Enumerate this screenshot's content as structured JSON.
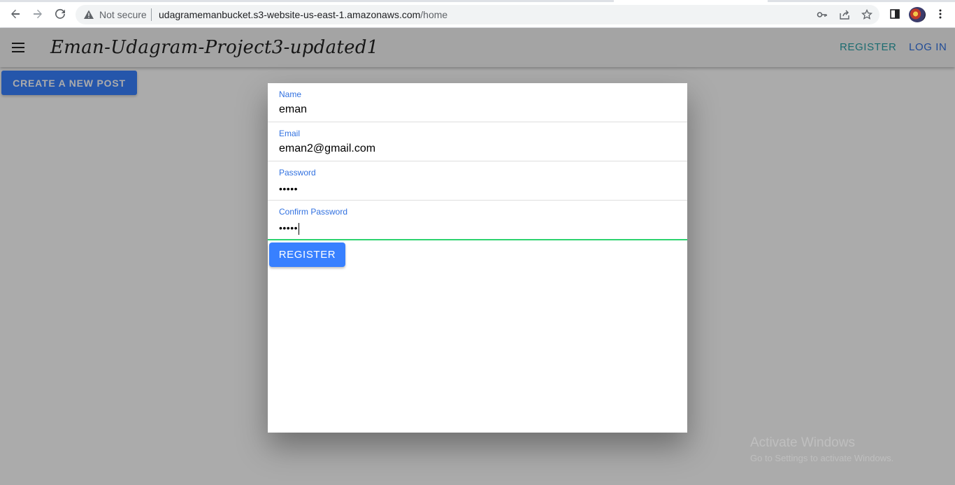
{
  "browser": {
    "security_status": "Not secure",
    "url_host": "udagramemanbucket.s3-website-us-east-1.amazonaws.com",
    "url_path": "/home"
  },
  "app": {
    "title": "Eman-Udagram-Project3-updated1",
    "nav": {
      "register_label": "REGISTER",
      "login_label": "LOG IN"
    },
    "create_post_label": "CREATE A NEW POST"
  },
  "register_form": {
    "fields": [
      {
        "label": "Name",
        "value": "eman"
      },
      {
        "label": "Email",
        "value": "eman2@gmail.com"
      },
      {
        "label": "Password",
        "value": "•••••"
      },
      {
        "label": "Confirm Password",
        "value": "•••••"
      }
    ],
    "submit_label": "REGISTER"
  },
  "watermark": {
    "title": "Activate Windows",
    "subtitle": "Go to Settings to activate Windows."
  },
  "colors": {
    "primary": "#3880ff",
    "teal_link": "#2aa1a8",
    "label_blue": "#3171e0",
    "focus_green": "#2dd36f"
  }
}
